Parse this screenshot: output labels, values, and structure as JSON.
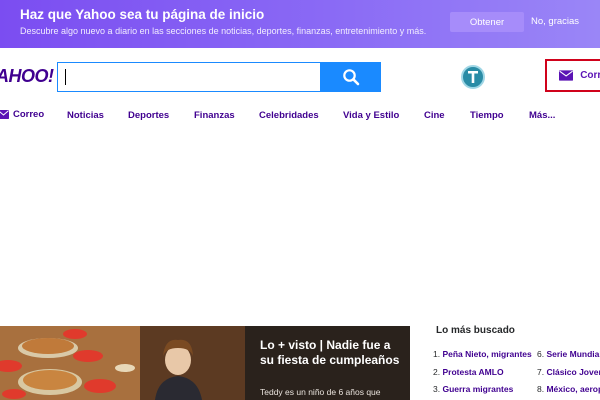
{
  "banner": {
    "title": "Haz que Yahoo sea tu página de inicio",
    "subtitle": "Descubre algo nuevo a diario en las secciones de noticias, deportes, finanzas, entretenimiento y más.",
    "get_label": "Obtener",
    "decline_label": "No, gracias"
  },
  "header": {
    "logo_text": "AHOO!",
    "search_value": "",
    "search_icon": "search-icon",
    "avatar_icon": "user-avatar",
    "mail_label": "Correo"
  },
  "nav": {
    "items": [
      {
        "label": "Correo",
        "icon": "mail-icon"
      },
      {
        "label": "Noticias"
      },
      {
        "label": "Deportes"
      },
      {
        "label": "Finanzas"
      },
      {
        "label": "Celebridades"
      },
      {
        "label": "Vida y Estilo"
      },
      {
        "label": "Cine"
      },
      {
        "label": "Tiempo"
      },
      {
        "label": "Más..."
      }
    ]
  },
  "featured": {
    "title": "Lo + visto | Nadie fue a su fiesta de cumpleaños",
    "description": "Teddy es un niño de 6 años que"
  },
  "trending": {
    "title": "Lo más buscado",
    "items": [
      {
        "num": "1.",
        "label": "Peña Nieto, migrantes"
      },
      {
        "num": "2.",
        "label": "Protesta AMLO"
      },
      {
        "num": "3.",
        "label": "Guerra migrantes"
      },
      {
        "num": "6.",
        "label": "Serie Mundial"
      },
      {
        "num": "7.",
        "label": "Clásico Joven"
      },
      {
        "num": "8.",
        "label": "México, aeropuerto"
      }
    ]
  },
  "colors": {
    "brand_purple": "#400090",
    "search_blue": "#1a8aff",
    "mail_highlight_red": "#d0021b"
  }
}
